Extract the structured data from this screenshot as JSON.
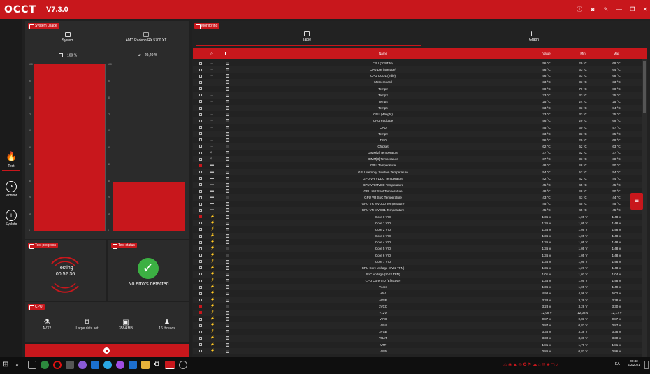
{
  "app": {
    "title": "OCCT",
    "version": "V7.3.0"
  },
  "sidebar": [
    {
      "label": "Test",
      "icon": "flame-icon"
    },
    {
      "label": "Monitor",
      "icon": "gauge-icon"
    },
    {
      "label": "SysInfo",
      "icon": "info-icon"
    }
  ],
  "system_usage": {
    "title": "System usage",
    "tabs": [
      "System",
      "AMD Radeon RX 5700 XT"
    ],
    "cpu_pct": "100 %",
    "gpu_pct": "29,20 %",
    "cpu_value": 100,
    "gpu_value": 29.2,
    "ticks": [
      "100",
      "90",
      "80",
      "70",
      "60",
      "50",
      "40",
      "30",
      "20",
      "10",
      "0"
    ]
  },
  "test_progress": {
    "title": "Test progress",
    "status": "Testing",
    "time": "00:52:36"
  },
  "test_status": {
    "title": "Test status",
    "message": "No errors detected"
  },
  "cpu": {
    "title": "CPU",
    "items": [
      {
        "label": "AVX2",
        "icon": "flask-icon"
      },
      {
        "label": "Large data set",
        "icon": "gears-icon"
      },
      {
        "label": "3584 MB",
        "icon": "chip-icon"
      },
      {
        "label": "16 threads",
        "icon": "user-icon"
      }
    ]
  },
  "monitoring": {
    "title": "Monitoring",
    "tabs": [
      "Table",
      "Graph"
    ],
    "headers": {
      "name": "Name",
      "value": "Value",
      "min": "Min",
      "max": "Max"
    }
  },
  "rows": [
    [
      "CPU (Tctl/Tdie)",
      "56 °C",
      "29 °C",
      "69 °C",
      0,
      "t"
    ],
    [
      "CPU Die (average)",
      "56 °C",
      "33 °C",
      "64 °C",
      0,
      "t"
    ],
    [
      "CPU CCD1 (Tdie)",
      "56 °C",
      "33 °C",
      "68 °C",
      0,
      "t"
    ],
    [
      "Motherboard",
      "33 °C",
      "33 °C",
      "33 °C",
      0,
      "t"
    ],
    [
      "Temp2",
      "80 °C",
      "79 °C",
      "80 °C",
      0,
      "t"
    ],
    [
      "Temp3",
      "33 °C",
      "33 °C",
      "35 °C",
      0,
      "t"
    ],
    [
      "Temp4",
      "25 °C",
      "24 °C",
      "25 °C",
      0,
      "t"
    ],
    [
      "Temp5",
      "83 °C",
      "83 °C",
      "84 °C",
      0,
      "t"
    ],
    [
      "CPU (Weight)",
      "33 °C",
      "33 °C",
      "35 °C",
      0,
      "t"
    ],
    [
      "CPU Package",
      "56 °C",
      "29 °C",
      "69 °C",
      0,
      "t"
    ],
    [
      "CPU",
      "45 °C",
      "30 °C",
      "57 °C",
      0,
      "t"
    ],
    [
      "Temp9",
      "33 °C",
      "33 °C",
      "35 °C",
      0,
      "t"
    ],
    [
      "TSI0",
      "56 °C",
      "29 °C",
      "69 °C",
      0,
      "t"
    ],
    [
      "Chipset",
      "62 °C",
      "62 °C",
      "63 °C",
      0,
      "t"
    ],
    [
      "DIMM[2] Temperature",
      "37 °C",
      "32 °C",
      "37 °C",
      0,
      "m"
    ],
    [
      "DIMM[3] Temperature",
      "37 °C",
      "33 °C",
      "38 °C",
      0,
      "m"
    ],
    [
      "GPU Temperature",
      "48 °C",
      "48 °C",
      "50 °C",
      1,
      "g"
    ],
    [
      "GPU Memory Junction Temperature",
      "54 °C",
      "52 °C",
      "54 °C",
      0,
      "g"
    ],
    [
      "GPU VR VDDC Temperature",
      "42 °C",
      "42 °C",
      "44 °C",
      0,
      "g"
    ],
    [
      "GPU VR MVDD Temperature",
      "45 °C",
      "45 °C",
      "45 °C",
      0,
      "g"
    ],
    [
      "GPU Hot Spot Temperature",
      "48 °C",
      "48 °C",
      "50 °C",
      0,
      "g"
    ],
    [
      "GPU VR SoC Temperature",
      "43 °C",
      "43 °C",
      "44 °C",
      0,
      "g"
    ],
    [
      "GPU VR MVDD0 Temperature",
      "45 °C",
      "45 °C",
      "45 °C",
      0,
      "g"
    ],
    [
      "GPU VR MVDD1 Temperature",
      "45 °C",
      "45 °C",
      "45 °C",
      0,
      "g"
    ],
    [
      "Core 0 VID",
      "1,35 V",
      "1,05 V",
      "1,48 V",
      1,
      "v"
    ],
    [
      "Core 1 VID",
      "1,36 V",
      "1,05 V",
      "1,48 V",
      0,
      "v"
    ],
    [
      "Core 2 VID",
      "1,36 V",
      "1,05 V",
      "1,48 V",
      0,
      "v"
    ],
    [
      "Core 3 VID",
      "1,36 V",
      "1,05 V",
      "1,48 V",
      0,
      "v"
    ],
    [
      "Core 4 VID",
      "1,36 V",
      "1,05 V",
      "1,48 V",
      0,
      "v"
    ],
    [
      "Core 5 VID",
      "1,36 V",
      "1,05 V",
      "1,48 V",
      0,
      "v"
    ],
    [
      "Core 6 VID",
      "1,36 V",
      "1,05 V",
      "1,48 V",
      0,
      "v"
    ],
    [
      "Core 7 VID",
      "1,36 V",
      "1,05 V",
      "1,48 V",
      0,
      "v"
    ],
    [
      "CPU Core Voltage (SVI2 TFN)",
      "1,35 V",
      "1,26 V",
      "1,48 V",
      0,
      "v"
    ],
    [
      "SoC Voltage (SVI2 TFN)",
      "1,01 V",
      "1,01 V",
      "1,04 V",
      0,
      "v"
    ],
    [
      "CPU Core VID (Effective)",
      "1,35 V",
      "1,05 V",
      "1,48 V",
      0,
      "v"
    ],
    [
      "Vcore",
      "1,36 V",
      "1,05 V",
      "1,49 V",
      0,
      "v"
    ],
    [
      "+5V",
      "4,98 V",
      "4,98 V",
      "5,02 V",
      0,
      "v"
    ],
    [
      "AVSB",
      "3,38 V",
      "3,38 V",
      "3,38 V",
      0,
      "v"
    ],
    [
      "3VCC",
      "3,28 V",
      "3,28 V",
      "3,30 V",
      1,
      "v"
    ],
    [
      "+12V",
      "12,08 V",
      "12,08 V",
      "12,17 V",
      1,
      "v"
    ],
    [
      "VIN8",
      "0,87 V",
      "0,83 V",
      "0,87 V",
      0,
      "v"
    ],
    [
      "VIN4",
      "0,87 V",
      "0,83 V",
      "0,87 V",
      0,
      "v"
    ],
    [
      "3VSB",
      "3,38 V",
      "3,38 V",
      "3,38 V",
      0,
      "v"
    ],
    [
      "VBAT",
      "3,30 V",
      "3,30 V",
      "3,30 V",
      0,
      "v"
    ],
    [
      "VTT",
      "1,81 V",
      "1,79 V",
      "1,81 V",
      0,
      "v"
    ],
    [
      "VIN5",
      "0,86 V",
      "0,83 V",
      "0,86 V",
      0,
      "v"
    ]
  ],
  "taskbar": {
    "time": "00:43",
    "date": "2/2/2021",
    "lang": "EA"
  }
}
